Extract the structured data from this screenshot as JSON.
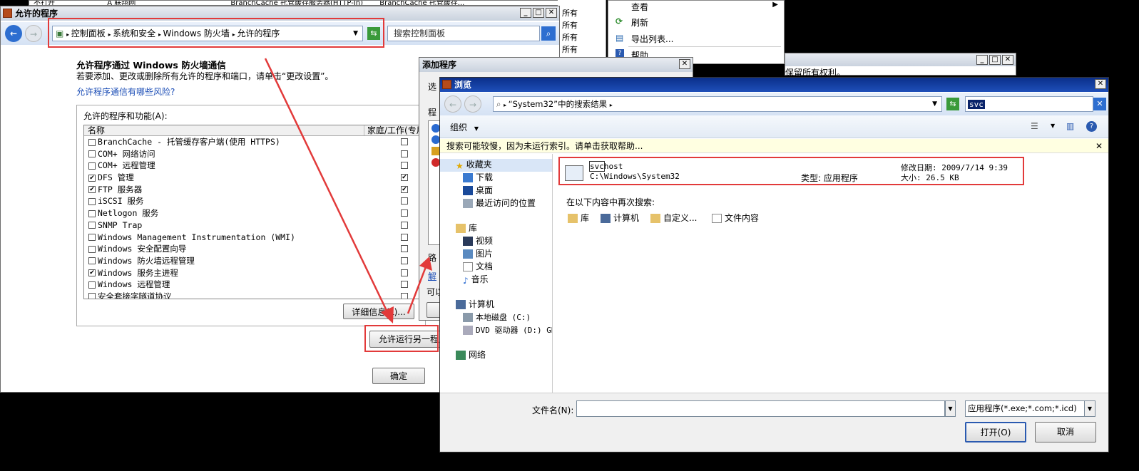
{
  "bg_top": {
    "tab1": "不打开",
    "tab2": "A 联翔网",
    "tab3": "BranchCache 托管缓存服务器(HTTP-In)",
    "tab4": "BranchCache 托管缓存...",
    "rights": [
      "所有",
      "所有",
      "所有",
      "所有",
      "所有",
      "所有"
    ],
    "menu": [
      "查看",
      "刷新",
      "导出列表...",
      "帮助"
    ],
    "copyright": "保留所有权利。"
  },
  "fw": {
    "title": "允许的程序",
    "breadcrumb": [
      "控制面板",
      "系统和安全",
      "Windows 防火墙",
      "允许的程序"
    ],
    "search_placeholder": "搜索控制面板",
    "heading": "允许程序通过 Windows 防火墙通信",
    "desc": "若要添加、更改或删除所有允许的程序和端口，请单击“更改设置”。",
    "risk_link": "允许程序通信有哪些风险?",
    "group_label": "允许的程序和功能(A):",
    "col_name": "名称",
    "col_home": "家庭/工作(专用)",
    "programs": [
      {
        "name": "BranchCache - 托管缓存客户端(使用 HTTPS)",
        "on": "",
        "home": ""
      },
      {
        "name": "COM+ 网络访问",
        "on": "",
        "home": ""
      },
      {
        "name": "COM+ 远程管理",
        "on": "",
        "home": ""
      },
      {
        "name": "DFS 管理",
        "on": "✔",
        "home": "✔"
      },
      {
        "name": "FTP 服务器",
        "on": "✔",
        "home": "✔"
      },
      {
        "name": "iSCSI 服务",
        "on": "",
        "home": ""
      },
      {
        "name": "Netlogon 服务",
        "on": "",
        "home": ""
      },
      {
        "name": "SNMP Trap",
        "on": "",
        "home": ""
      },
      {
        "name": "Windows Management Instrumentation (WMI)",
        "on": "",
        "home": ""
      },
      {
        "name": "Windows 安全配置向导",
        "on": "",
        "home": ""
      },
      {
        "name": "Windows 防火墙远程管理",
        "on": "",
        "home": ""
      },
      {
        "name": "Windows 服务主进程",
        "on": "✔",
        "home": ""
      },
      {
        "name": "Windows 远程管理",
        "on": "",
        "home": ""
      },
      {
        "name": "安全套接字隧道协议",
        "on": "",
        "home": ""
      }
    ],
    "details_btn": "详细信息(L)...",
    "allow_other_btn": "允许运行另一程序(R)...",
    "ok_btn": "确定"
  },
  "add": {
    "title": "添加程序",
    "frag1": "选",
    "frag2": "程",
    "frag3": "路",
    "frag4": "解",
    "frag5": "可以"
  },
  "browse": {
    "title": "浏览",
    "path": "“System32”中的搜索结果",
    "search_value": "svc",
    "organize": "组织",
    "info_bar": "搜索可能较慢，因为未运行索引。请单击获取帮助...",
    "nav": {
      "favorites": "收藏夹",
      "fav_items": [
        "下载",
        "桌面",
        "最近访问的位置"
      ],
      "libraries": "库",
      "lib_items": [
        "视频",
        "图片",
        "文档",
        "音乐"
      ],
      "computer": "计算机",
      "comp_items": [
        "本地磁盘 (C:)",
        "DVD 驱动器 (D:) GR"
      ],
      "network": "网络"
    },
    "result": {
      "name_hl": "svc",
      "name_rest": "host",
      "path": "C:\\Windows\\System32",
      "type": "类型: 应用程序",
      "modified": "修改日期: 2009/7/14 9:39",
      "size": "大小: 26.5 KB"
    },
    "search_again": "在以下内容中再次搜索:",
    "search_again_items": [
      "库",
      "计算机",
      "自定义...",
      "文件内容"
    ],
    "filename_label": "文件名(N):",
    "filename_value": "",
    "filter": "应用程序(*.exe;*.com;*.icd)",
    "open_btn": "打开(O)",
    "cancel_btn": "取消"
  },
  "colors": {
    "annotation_red": "#e23a3a",
    "title_active": "#0b2f8a",
    "link": "#1b4db6",
    "info_bar": "#ffffe1"
  }
}
